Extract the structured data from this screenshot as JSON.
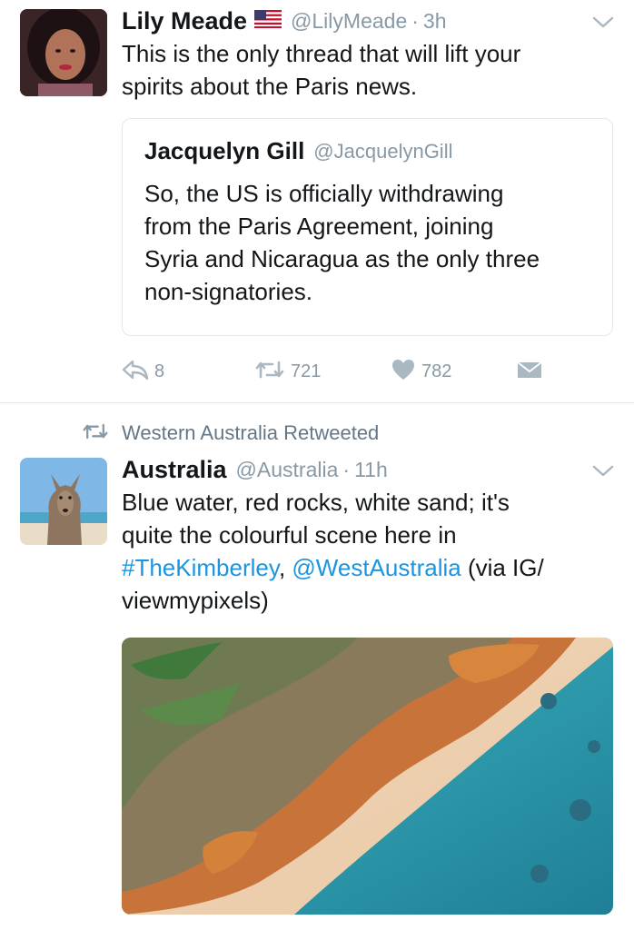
{
  "tweet1": {
    "display_name": "Lily Meade",
    "handle": "@LilyMeade",
    "separator": "·",
    "time": "3h",
    "text_lines": [
      "This is the only thread that will lift your",
      "spirits about the Paris news."
    ],
    "flag_icon": "us-flag-icon",
    "quoted": {
      "display_name": "Jacquelyn Gill",
      "handle": "@JacquelynGill",
      "text_lines": [
        "So, the US is officially withdrawing",
        "from the Paris Agreement, joining",
        "Syria and Nicaragua as the only three",
        "non-signatories."
      ]
    },
    "actions": {
      "reply_count": "8",
      "retweet_count": "721",
      "like_count": "782"
    }
  },
  "retweet_banner": {
    "text": "Western Australia Retweeted"
  },
  "tweet2": {
    "display_name": "Australia",
    "handle": "@Australia",
    "separator": "·",
    "time": "11h",
    "line1": "Blue water, red rocks, white sand; it's",
    "line2": "quite the colourful scene here in",
    "hashtag": "#TheKimberley",
    "comma": ",",
    "mention": "@WestAustralia",
    "line3_rest": " (via IG/",
    "line4": "viewmypixels)"
  },
  "colors": {
    "text": "#14171a",
    "secondary": "#8899a6",
    "link": "#1b95e0",
    "border": "#e1e8ed"
  }
}
